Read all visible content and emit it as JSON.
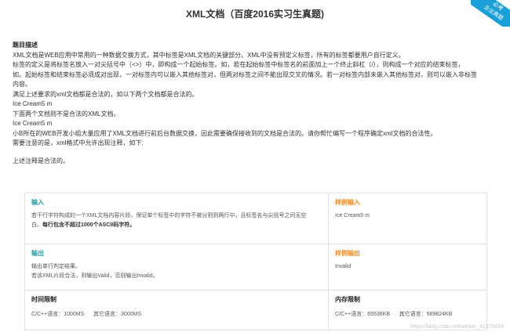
{
  "page": {
    "title": "XML文档（百度2016实习生真题)",
    "ribbon_line1": "必考",
    "ribbon_line2": "企业真题"
  },
  "description": {
    "heading": "题目描述",
    "lines": [
      "XML文档是WEB应用中常用的一种数据交换方式，其中标签是XML文档的关键部分。XML中没有预定义标签，所有的标签都要用户自行定义。",
      "标签的定义是将标签名放入一对尖括号中（<>）中，即构成一个起始标签。如，若在起始标签中标签名的前面加上一个终止斜杠（/），则构成一个对应的结束标签，",
      "如。起始标签和结束标签必须成对出现，一对标签内可以嵌入其他标签对，但两对标签之间不能出现交叉的情况。若一对标签内部未嵌入其他标签对，则可以嵌入非标签",
      "内容。",
      "满足上述要求的xml文档都是合法的，如以下两个文档都是合法的。",
      "Ice Cream5 m",
      "下面两个文档则不是合法的XML文档。",
      "Ice Cream5 m",
      "小B所在的WEB开发小组大量应用了XML文档进行前后台数据交换，因此需要确保接收到的文档是合法的。请你帮忙编写一个程序确定xml文档的合法性。",
      "需要注意的是，xml格式中允许出现注释，如下:"
    ],
    "trailing": "上述注释是合法的。"
  },
  "table": {
    "input_label": "输入",
    "input_text1": "若干行字符构成的一个XML文档内容片段，保证单个标签中的字符不被分割到两行中，且标签名与尖括号之间无空",
    "input_text2": "白。",
    "input_text3": "每行包含不超过1000个ASCII码字符。",
    "sample_input_label": "样例输入",
    "sample_input_value": "Ice Cream5 m",
    "output_label": "输出",
    "output_text1": "输出单行判定结果。",
    "output_text2": "若该XML片段合法，则输出Valid，否则输出Invalid。",
    "sample_output_label": "样例输出",
    "sample_output_value": "Invalid",
    "time_label": "时间限制",
    "time_value": "C/C++语言：1000MS      其它语言：3000MS",
    "memory_label": "内存限制",
    "memory_value": "C/C++语言：65536KB      其它语言：589824KB"
  },
  "watermark": "https://blog.csdn.net/weixin_41370424"
}
